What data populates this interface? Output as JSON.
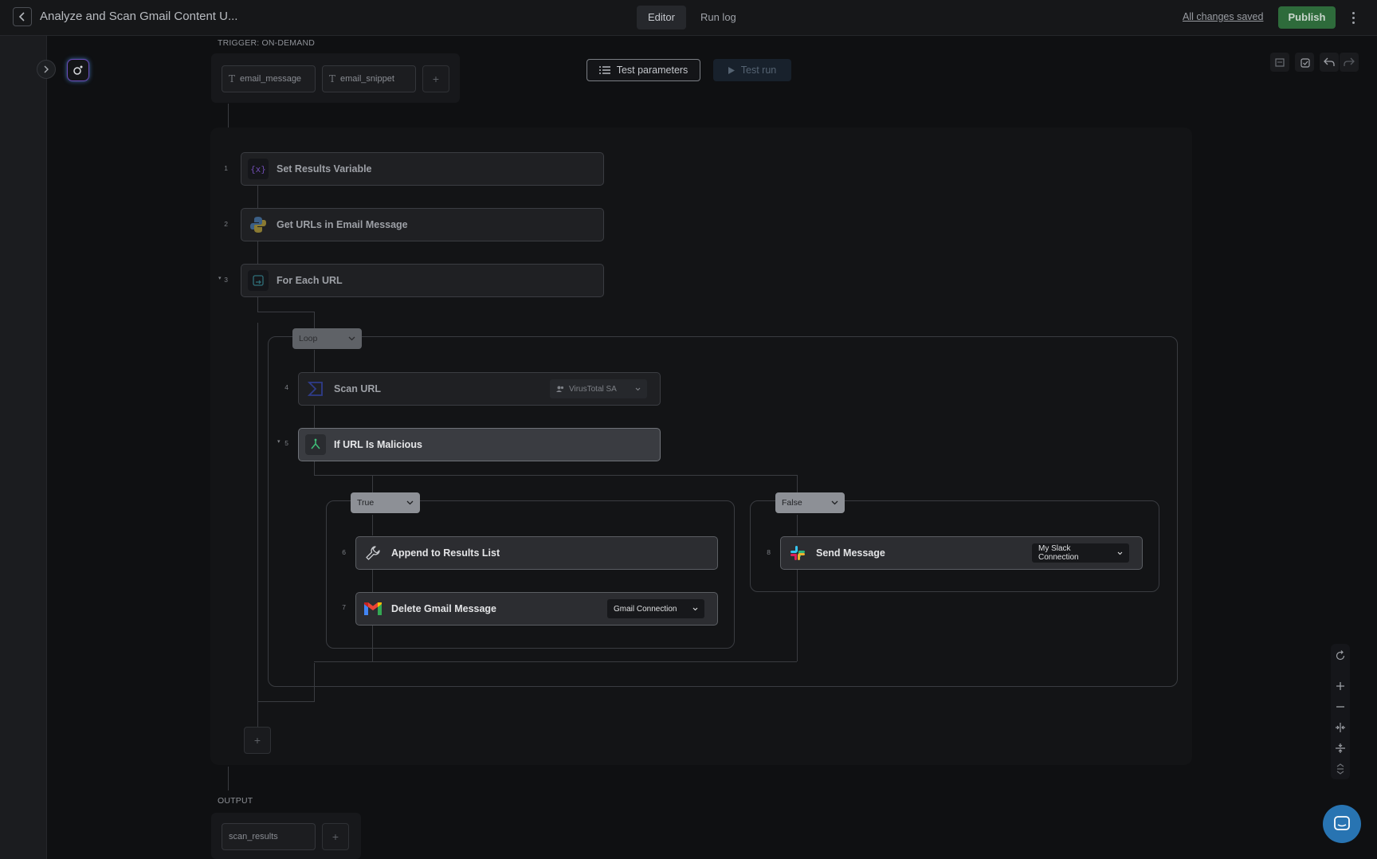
{
  "header": {
    "title": "Analyze and Scan Gmail Content U...",
    "tabs": [
      {
        "label": "Editor",
        "active": true
      },
      {
        "label": "Run log",
        "active": false
      }
    ],
    "save_status": "All changes saved",
    "publish_label": "Publish"
  },
  "trigger": {
    "label": "TRIGGER: ON-DEMAND",
    "params": [
      "email_message",
      "email_snippet"
    ],
    "add_icon": "plus-icon"
  },
  "toolbar": {
    "test_parameters_label": "Test parameters",
    "test_run_label": "Test run"
  },
  "steps": {
    "s1": {
      "num": "1",
      "name": "Set Results Variable",
      "icon": "variable-icon"
    },
    "s2": {
      "num": "2",
      "name": "Get URLs in Email Message",
      "icon": "python-icon"
    },
    "s3": {
      "num": "3",
      "name": "For Each URL",
      "icon": "loop-icon"
    },
    "s4": {
      "num": "4",
      "name": "Scan URL",
      "icon": "virustotal-icon",
      "connection": "VirusTotal SA"
    },
    "s5": {
      "num": "5",
      "name": "If URL Is Malicious",
      "icon": "branch-icon"
    },
    "s6": {
      "num": "6",
      "name": "Append to Results List",
      "icon": "wrench-icon"
    },
    "s7": {
      "num": "7",
      "name": "Delete Gmail Message",
      "icon": "gmail-icon",
      "connection": "Gmail Connection"
    },
    "s8": {
      "num": "8",
      "name": "Send Message",
      "icon": "slack-icon",
      "connection": "My Slack Connection"
    }
  },
  "branches": {
    "loop_label": "Loop",
    "true_label": "True",
    "false_label": "False"
  },
  "output": {
    "label": "OUTPUT",
    "params": [
      "scan_results"
    ]
  },
  "colors": {
    "publish": "#2e6b3b",
    "accent_blue": "#2874b2",
    "active_node": "#3a3c41"
  }
}
